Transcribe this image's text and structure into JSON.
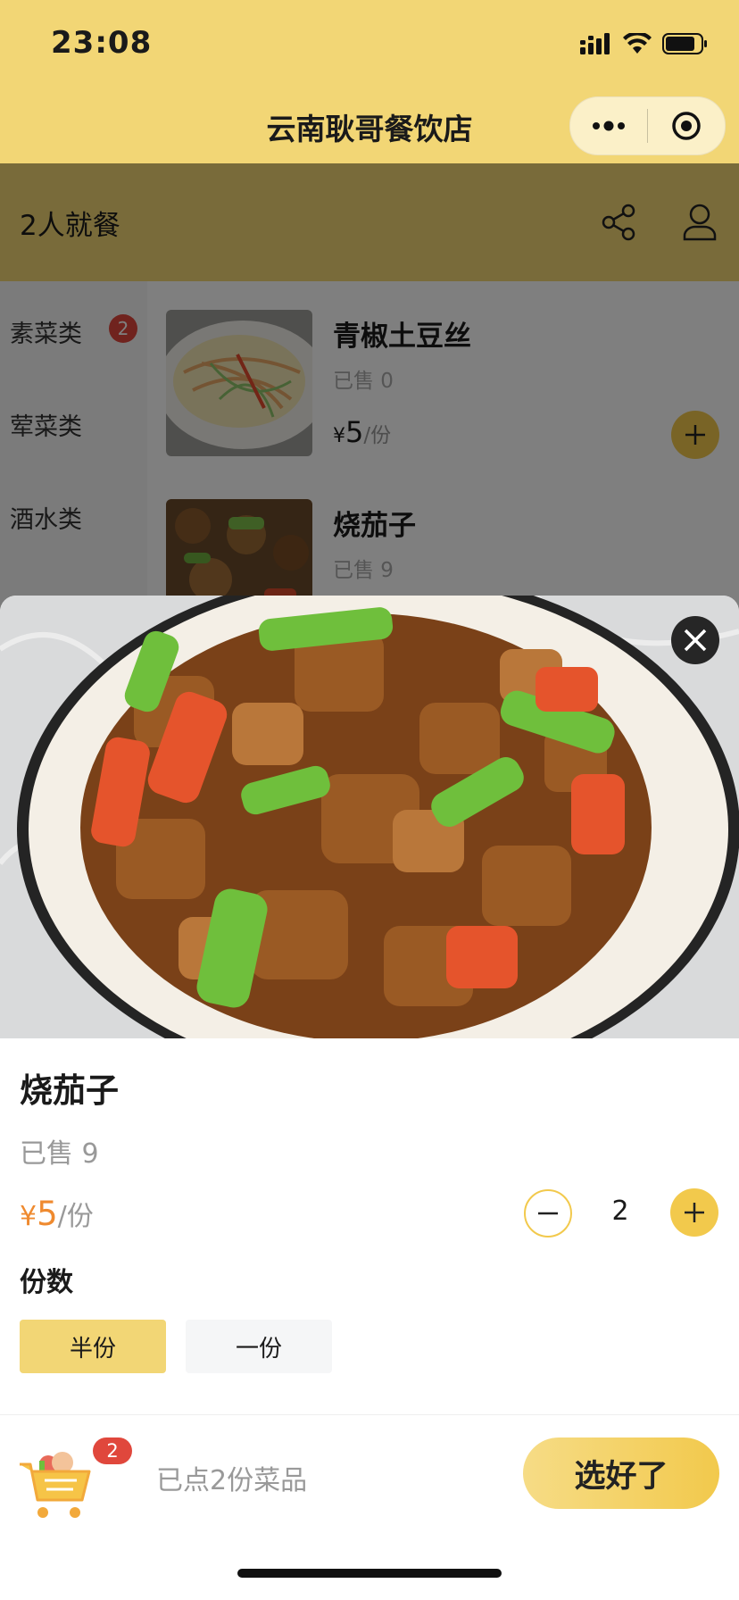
{
  "status_bar": {
    "time": "23:08"
  },
  "nav": {
    "title": "云南耿哥餐饮店"
  },
  "header": {
    "party_label": "2人就餐"
  },
  "sidebar": {
    "items": [
      {
        "label": "素菜类",
        "badge": "2"
      },
      {
        "label": "荤菜类"
      },
      {
        "label": "酒水类"
      }
    ]
  },
  "dishes": [
    {
      "name": "青椒土豆丝",
      "sold": "已售 0",
      "currency": "¥",
      "price": "5",
      "unit": "/份"
    },
    {
      "name": "烧茄子",
      "sold": "已售 9"
    }
  ],
  "detail": {
    "name": "烧茄子",
    "sold": "已售 9",
    "currency": "¥",
    "price": "5",
    "unit": "/份",
    "quantity": "2",
    "portion_label": "份数",
    "options": [
      {
        "label": "半份",
        "selected": true
      },
      {
        "label": "一份",
        "selected": false
      }
    ]
  },
  "cart": {
    "badge": "2",
    "summary": "已点2份菜品",
    "confirm_label": "选好了"
  },
  "colors": {
    "brand_yellow": "#f2d675",
    "button_yellow": "#f2c94c",
    "price_orange": "#ef8a2f",
    "badge_red": "#e0473c"
  }
}
